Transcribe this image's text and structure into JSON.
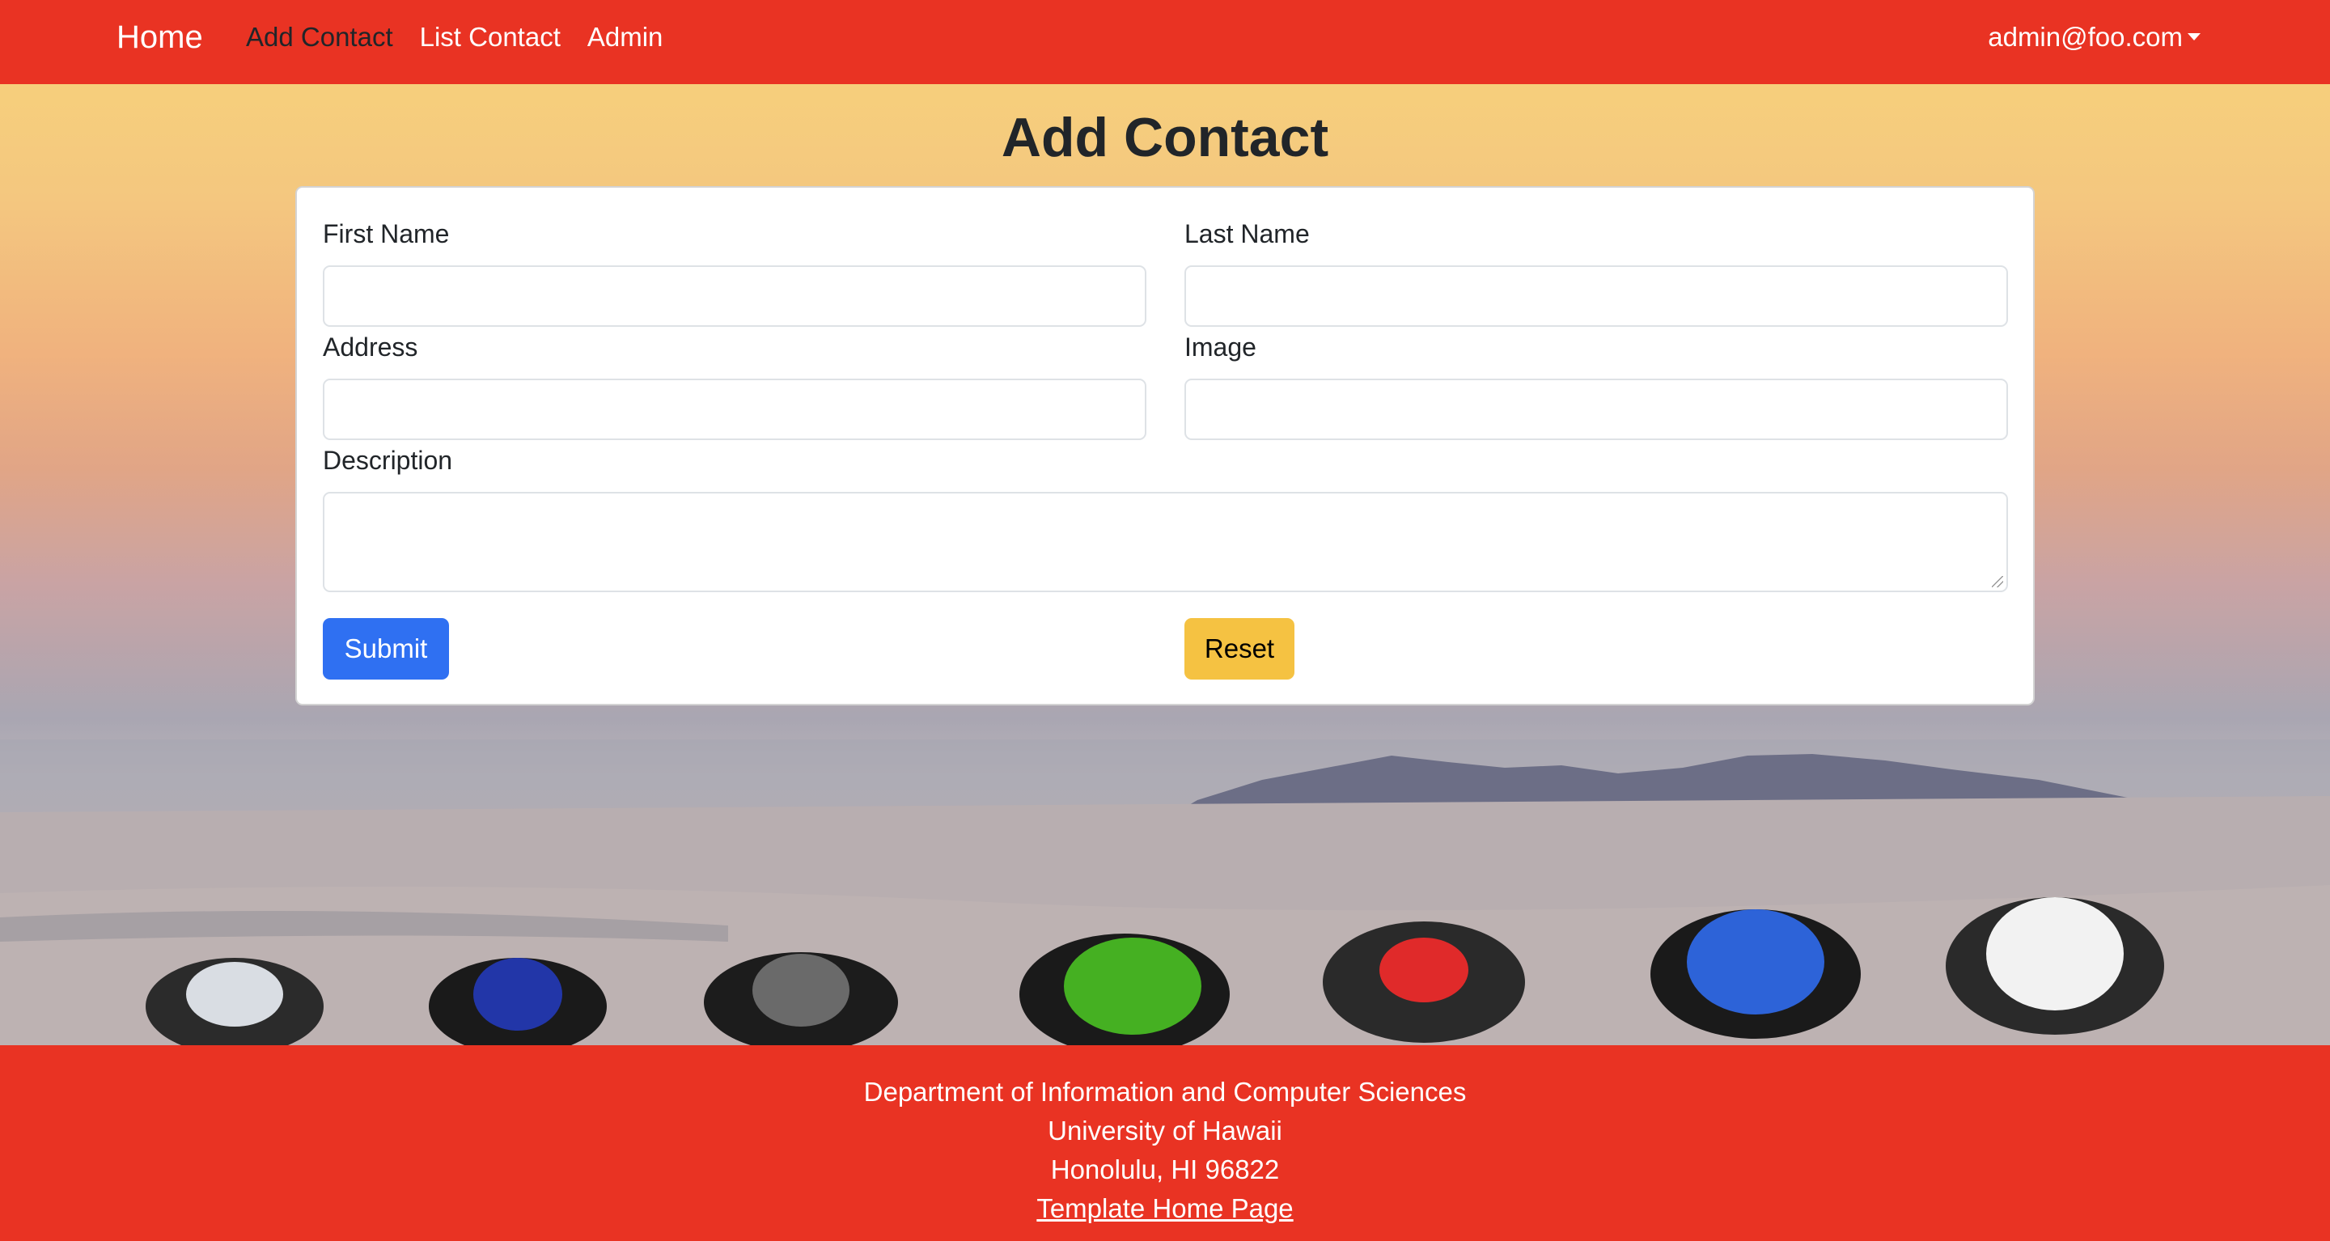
{
  "navbar": {
    "brand": "Home",
    "links": [
      {
        "label": "Add Contact",
        "active": true
      },
      {
        "label": "List Contact",
        "active": false
      },
      {
        "label": "Admin",
        "active": false
      }
    ],
    "user": "admin@foo.com"
  },
  "page": {
    "title": "Add Contact"
  },
  "form": {
    "first_name_label": "First Name",
    "first_name_value": "",
    "last_name_label": "Last Name",
    "last_name_value": "",
    "address_label": "Address",
    "address_value": "",
    "image_label": "Image",
    "image_value": "",
    "description_label": "Description",
    "description_value": "",
    "submit_label": "Submit",
    "reset_label": "Reset"
  },
  "footer": {
    "line1": "Department of Information and Computer Sciences",
    "line2": "University of Hawaii",
    "line3": "Honolulu, HI 96822",
    "link": "Template Home Page"
  },
  "colors": {
    "navbar": "#e93323",
    "footer": "#e93323",
    "submit": "#2f70f2",
    "reset": "#f5c242"
  }
}
